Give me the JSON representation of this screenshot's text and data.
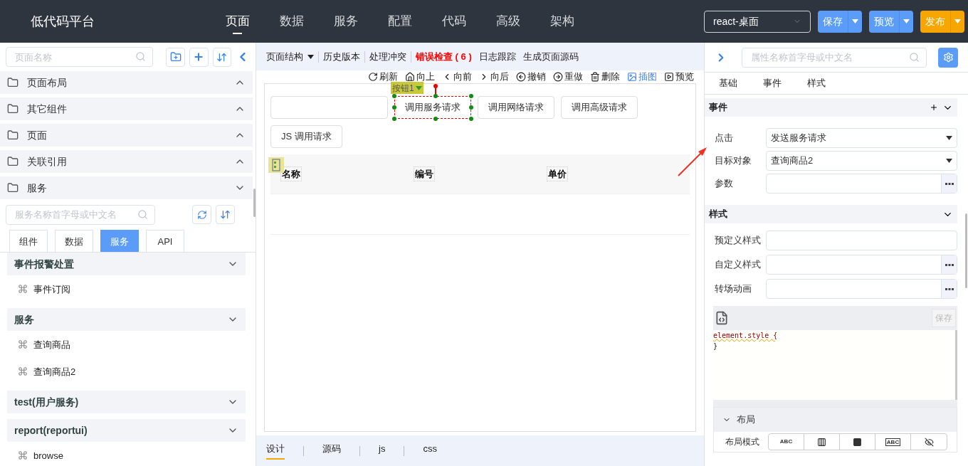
{
  "app_title": "低代码平台",
  "nav": [
    {
      "label": "页面",
      "selected": true
    },
    {
      "label": "数据",
      "selected": false
    },
    {
      "label": "服务",
      "selected": false
    },
    {
      "label": "配置",
      "selected": false
    },
    {
      "label": "代码",
      "selected": false
    },
    {
      "label": "高级",
      "selected": false
    },
    {
      "label": "架构",
      "selected": false
    }
  ],
  "platform_select": "react-桌面",
  "actions": [
    {
      "label": "保存",
      "kind": "save"
    },
    {
      "label": "预览",
      "kind": "preview"
    },
    {
      "label": "发布",
      "kind": "publish"
    }
  ],
  "left": {
    "page_search": {
      "placeholder": "页面名称"
    },
    "folders": [
      {
        "label": "页面布局",
        "expanded": false
      },
      {
        "label": "其它组件",
        "expanded": false
      },
      {
        "label": "页面",
        "expanded": false
      },
      {
        "label": "关联引用",
        "expanded": false
      },
      {
        "label": "服务",
        "expanded": true
      }
    ],
    "service_search": {
      "placeholder": "服务名称首字母或中文名"
    },
    "tabs": [
      {
        "label": "组件",
        "selected": false
      },
      {
        "label": "数据",
        "selected": false
      },
      {
        "label": "服务",
        "selected": true
      },
      {
        "label": "API",
        "selected": false
      }
    ],
    "groups": [
      {
        "title": "事件报警处置",
        "items": [
          "事件订阅"
        ]
      },
      {
        "title": "服务",
        "items": [
          "查询商品",
          "查询商品2"
        ]
      },
      {
        "title": "test(用户服务)"
      },
      {
        "title": "report(reportui)",
        "items": [
          "browse"
        ]
      }
    ]
  },
  "center": {
    "menu": [
      {
        "label": "页面结构",
        "kind": "dropdown"
      },
      {
        "label": "历史版本",
        "kind": "plain"
      },
      {
        "label": "处理冲突",
        "kind": "plain"
      },
      {
        "label": "错误检查 ( 6 )",
        "kind": "error"
      },
      {
        "label": "日志跟踪",
        "kind": "plain"
      },
      {
        "label": "生成页面源码",
        "kind": "plain"
      }
    ],
    "tools": [
      {
        "label": "刷新",
        "kind": "refresh",
        "selected": false
      },
      {
        "label": "向上",
        "kind": "up",
        "selected": false
      },
      {
        "label": "向前",
        "kind": "back",
        "selected": false
      },
      {
        "label": "向后",
        "kind": "forward",
        "selected": false
      },
      {
        "label": "撤销",
        "kind": "undo",
        "selected": false
      },
      {
        "label": "重做",
        "kind": "redo",
        "selected": false
      },
      {
        "label": "删除",
        "kind": "delete",
        "selected": false
      },
      {
        "label": "插图",
        "kind": "image",
        "selected": true
      },
      {
        "label": "预览",
        "kind": "preview",
        "selected": false
      }
    ],
    "component_badge": "按钮1",
    "buttons": [
      {
        "label": "调用服务请求",
        "selected": true
      },
      {
        "label": "调用网络请求",
        "selected": false
      },
      {
        "label": "调用高级请求",
        "selected": false
      },
      {
        "label": "JS 调用请求",
        "selected": false
      }
    ],
    "table_columns": [
      "名称",
      "编号",
      "单价"
    ],
    "bottom_tabs": [
      {
        "label": "设计",
        "selected": true
      },
      {
        "label": "源码",
        "selected": false
      },
      {
        "label": "js",
        "selected": false
      },
      {
        "label": "css",
        "selected": false
      }
    ]
  },
  "right": {
    "search": {
      "placeholder": "属性名称首字母或中文名"
    },
    "tabs": [
      "基础",
      "事件",
      "样式"
    ],
    "event_section": "事件",
    "event_fields": [
      {
        "label": "点击",
        "value": "发送服务请求",
        "kind": "select"
      },
      {
        "label": "目标对象",
        "value": "查询商品2",
        "kind": "select"
      },
      {
        "label": "参数",
        "kind": "picker"
      }
    ],
    "style_section": "样式",
    "style_fields": [
      {
        "label": "预定义样式",
        "kind": "text"
      },
      {
        "label": "自定义样式",
        "kind": "picker"
      },
      {
        "label": "转场动画",
        "kind": "picker"
      }
    ],
    "editor": {
      "save": "保存",
      "lines": [
        "element.style {",
        "}"
      ]
    },
    "layout_section": "布局",
    "layout_mode_label": "布局模式",
    "layout_options": [
      {
        "kind": "inline",
        "label": "ABC"
      },
      {
        "kind": "columns"
      },
      {
        "kind": "block"
      },
      {
        "kind": "boxed",
        "label": "ABC"
      },
      {
        "kind": "hidden"
      }
    ]
  }
}
